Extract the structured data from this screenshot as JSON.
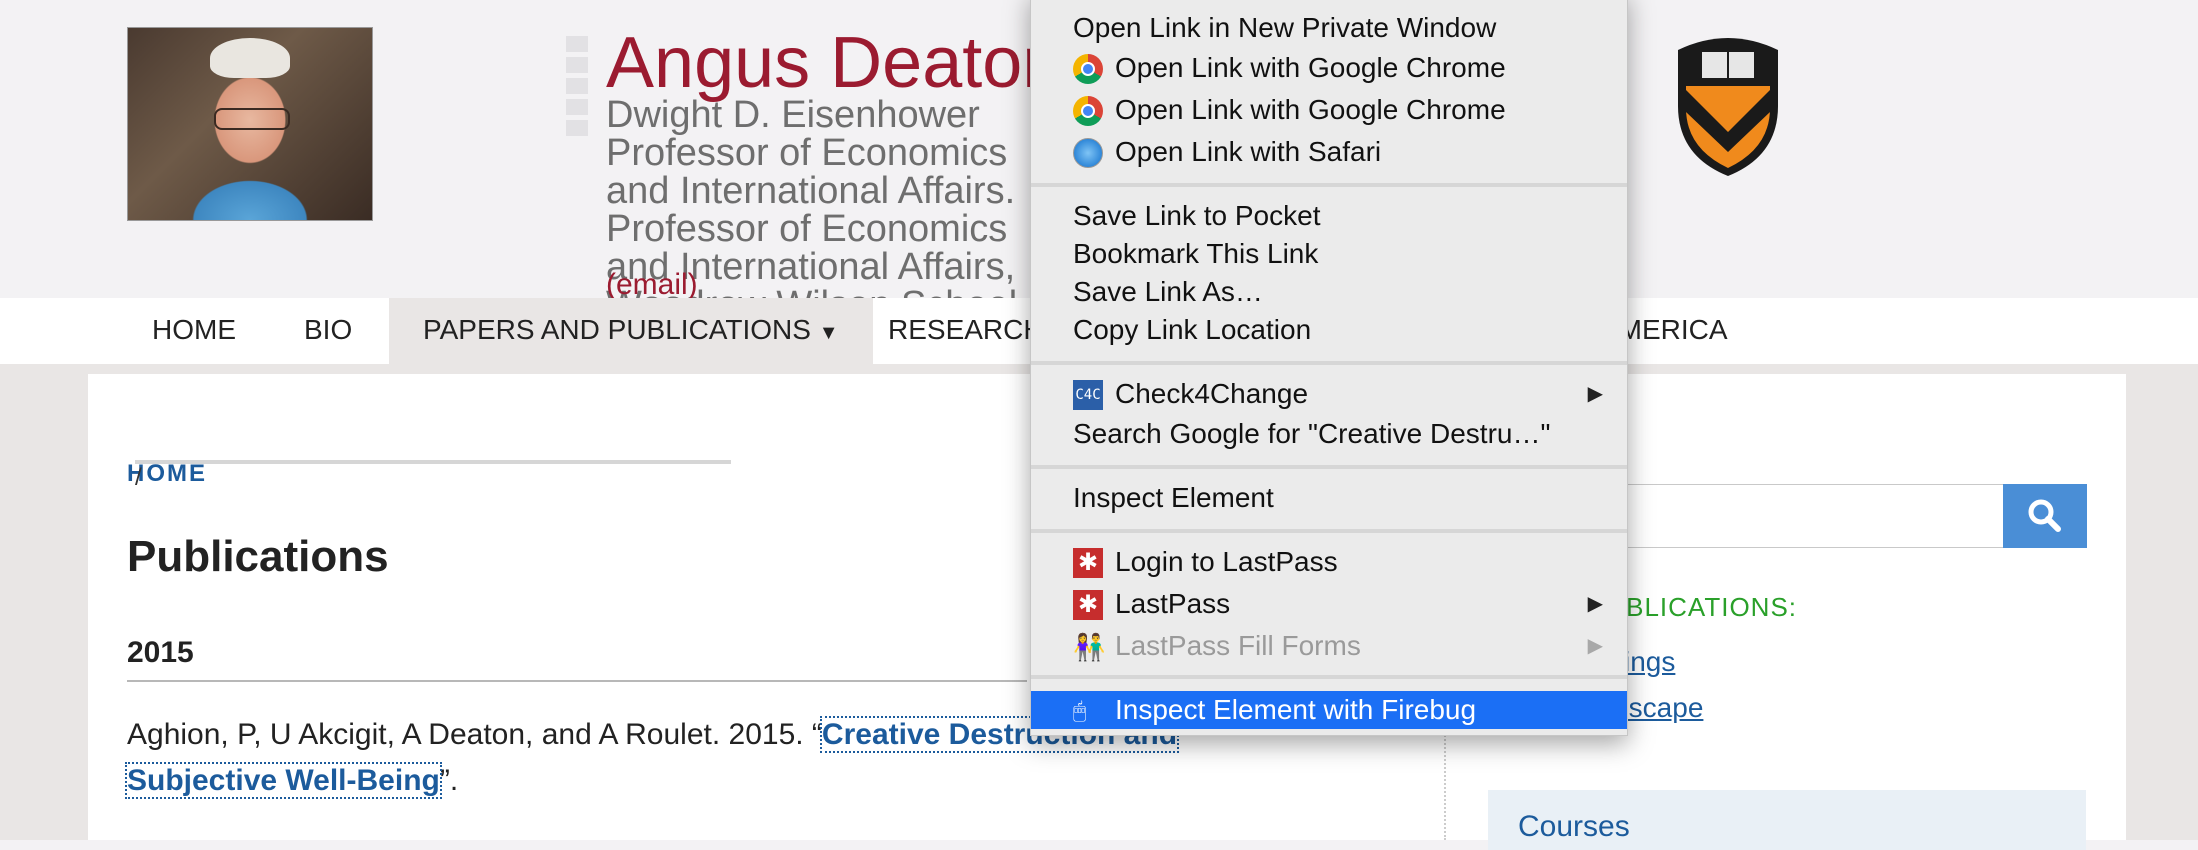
{
  "header": {
    "name": "Angus Deaton",
    "subtitle": "Dwight D. Eisenhower Professor of Economics and International Affairs. Professor of Economics and International Affairs, Woodrow Wilson School",
    "email": "(email)"
  },
  "nav": {
    "items": [
      "HOME",
      "BIO",
      "PAPERS AND PUBLICATIONS",
      "RESEARCH",
      "AMERICA"
    ],
    "dropdown_glyph": "▼"
  },
  "breadcrumb": {
    "home": "HOME",
    "sep": "/"
  },
  "page_title": "Publications",
  "year": "2015",
  "citation": {
    "prefix": "Aghion, P, U Akcigit, A Deaton, and A Roulet. 2015. “",
    "link": "Creative Destruction and Subjective Well-Being",
    "suffix": "”."
  },
  "sidebar": {
    "heading": "R PUBLICATIONS:",
    "link1": "itings",
    "link2": "Escape",
    "courses": "Courses"
  },
  "context_menu": {
    "items": [
      "Open Link in New Private Window",
      "Open Link with Google Chrome",
      "Open Link with Google Chrome",
      "Open Link with Safari",
      "Save Link to Pocket",
      "Bookmark This Link",
      "Save Link As…",
      "Copy Link Location",
      "Check4Change",
      "Search Google for \"Creative Destru…\"",
      "Inspect Element",
      "Login to LastPass",
      "LastPass",
      "LastPass Fill Forms",
      "Inspect Element with Firebug"
    ],
    "submenu_glyph": "▶",
    "c4c_glyph": "C4C",
    "lastpass_glyph": "✱",
    "fill_glyph": "👫",
    "firebug_glyph": "🖱"
  },
  "colors": {
    "brand_red": "#9b1b30",
    "link_blue": "#1c5b9c",
    "menu_highlight": "#1b6ff5",
    "search_button": "#4a8ed6",
    "sidebar_heading": "#2aa02a"
  },
  "icons": {
    "search": "search-icon",
    "shield": "princeton-shield-icon"
  }
}
